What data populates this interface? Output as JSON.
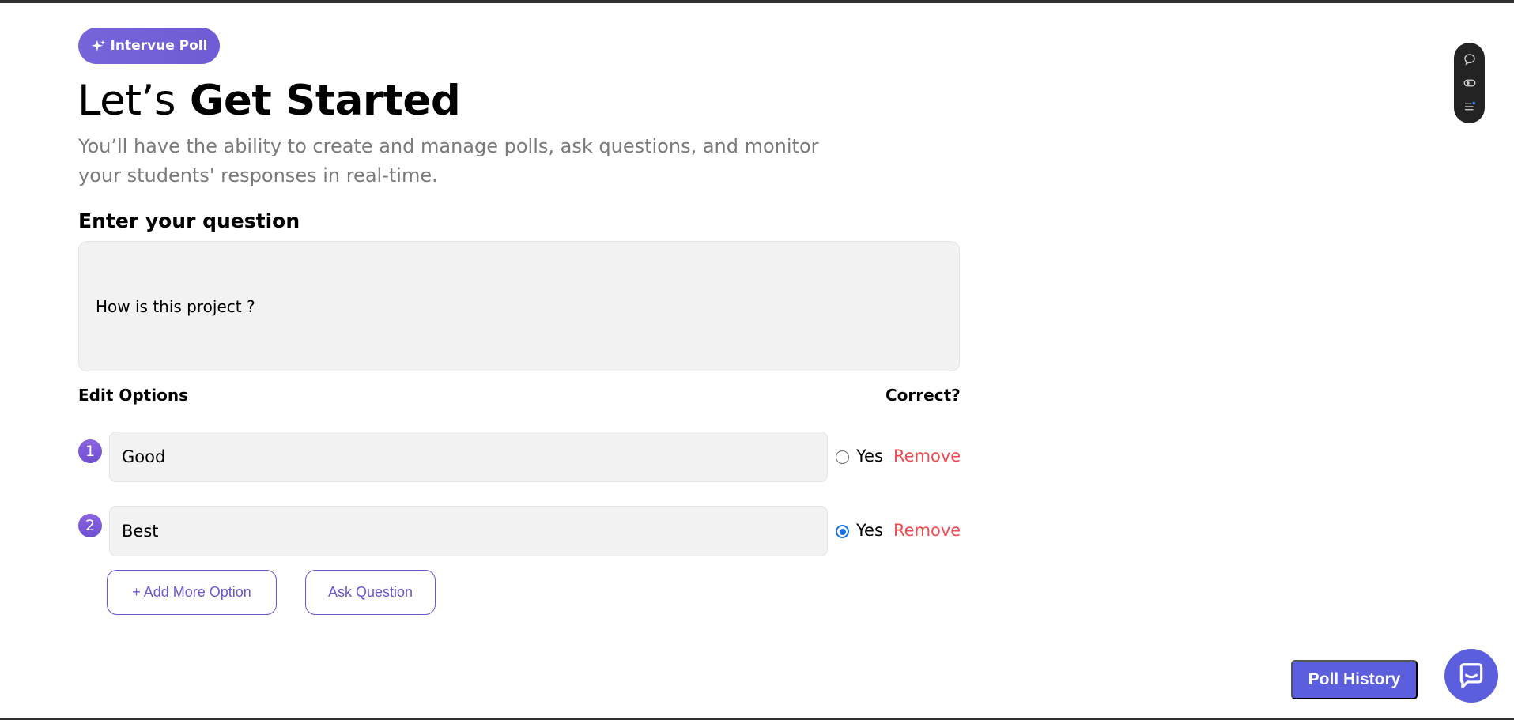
{
  "brand": {
    "label": "Intervue Poll",
    "icon": "sparkle-icon",
    "color": "#7565d9"
  },
  "header": {
    "title_prefix": "Let’s",
    "title_emphasis": "Get Started",
    "subtitle": "You’ll have the ability to create and manage polls, ask questions, and monitor your students' responses in real-time."
  },
  "question": {
    "label": "Enter your question",
    "value": "How is this project ?"
  },
  "options_section": {
    "label": "Edit Options",
    "correct_label": "Correct?"
  },
  "options": [
    {
      "number": "1",
      "value": "Good",
      "correct_label": "Yes",
      "is_correct": false,
      "remove_label": "Remove"
    },
    {
      "number": "2",
      "value": "Best",
      "correct_label": "Yes",
      "is_correct": true,
      "remove_label": "Remove"
    }
  ],
  "actions": {
    "add_option_label": "+ Add More Option",
    "ask_question_label": "Ask Question"
  },
  "floating_toolbar": {
    "icons": [
      "comment-icon",
      "toggle-icon",
      "list-icon"
    ]
  },
  "footer": {
    "poll_history_label": "Poll History",
    "chat_icon": "chat-bubble-icon"
  },
  "colors": {
    "accent_purple": "#6d55d3",
    "button_blue": "#5b5fde",
    "remove_red": "#f04b50",
    "radio_blue": "#1a73e8"
  }
}
